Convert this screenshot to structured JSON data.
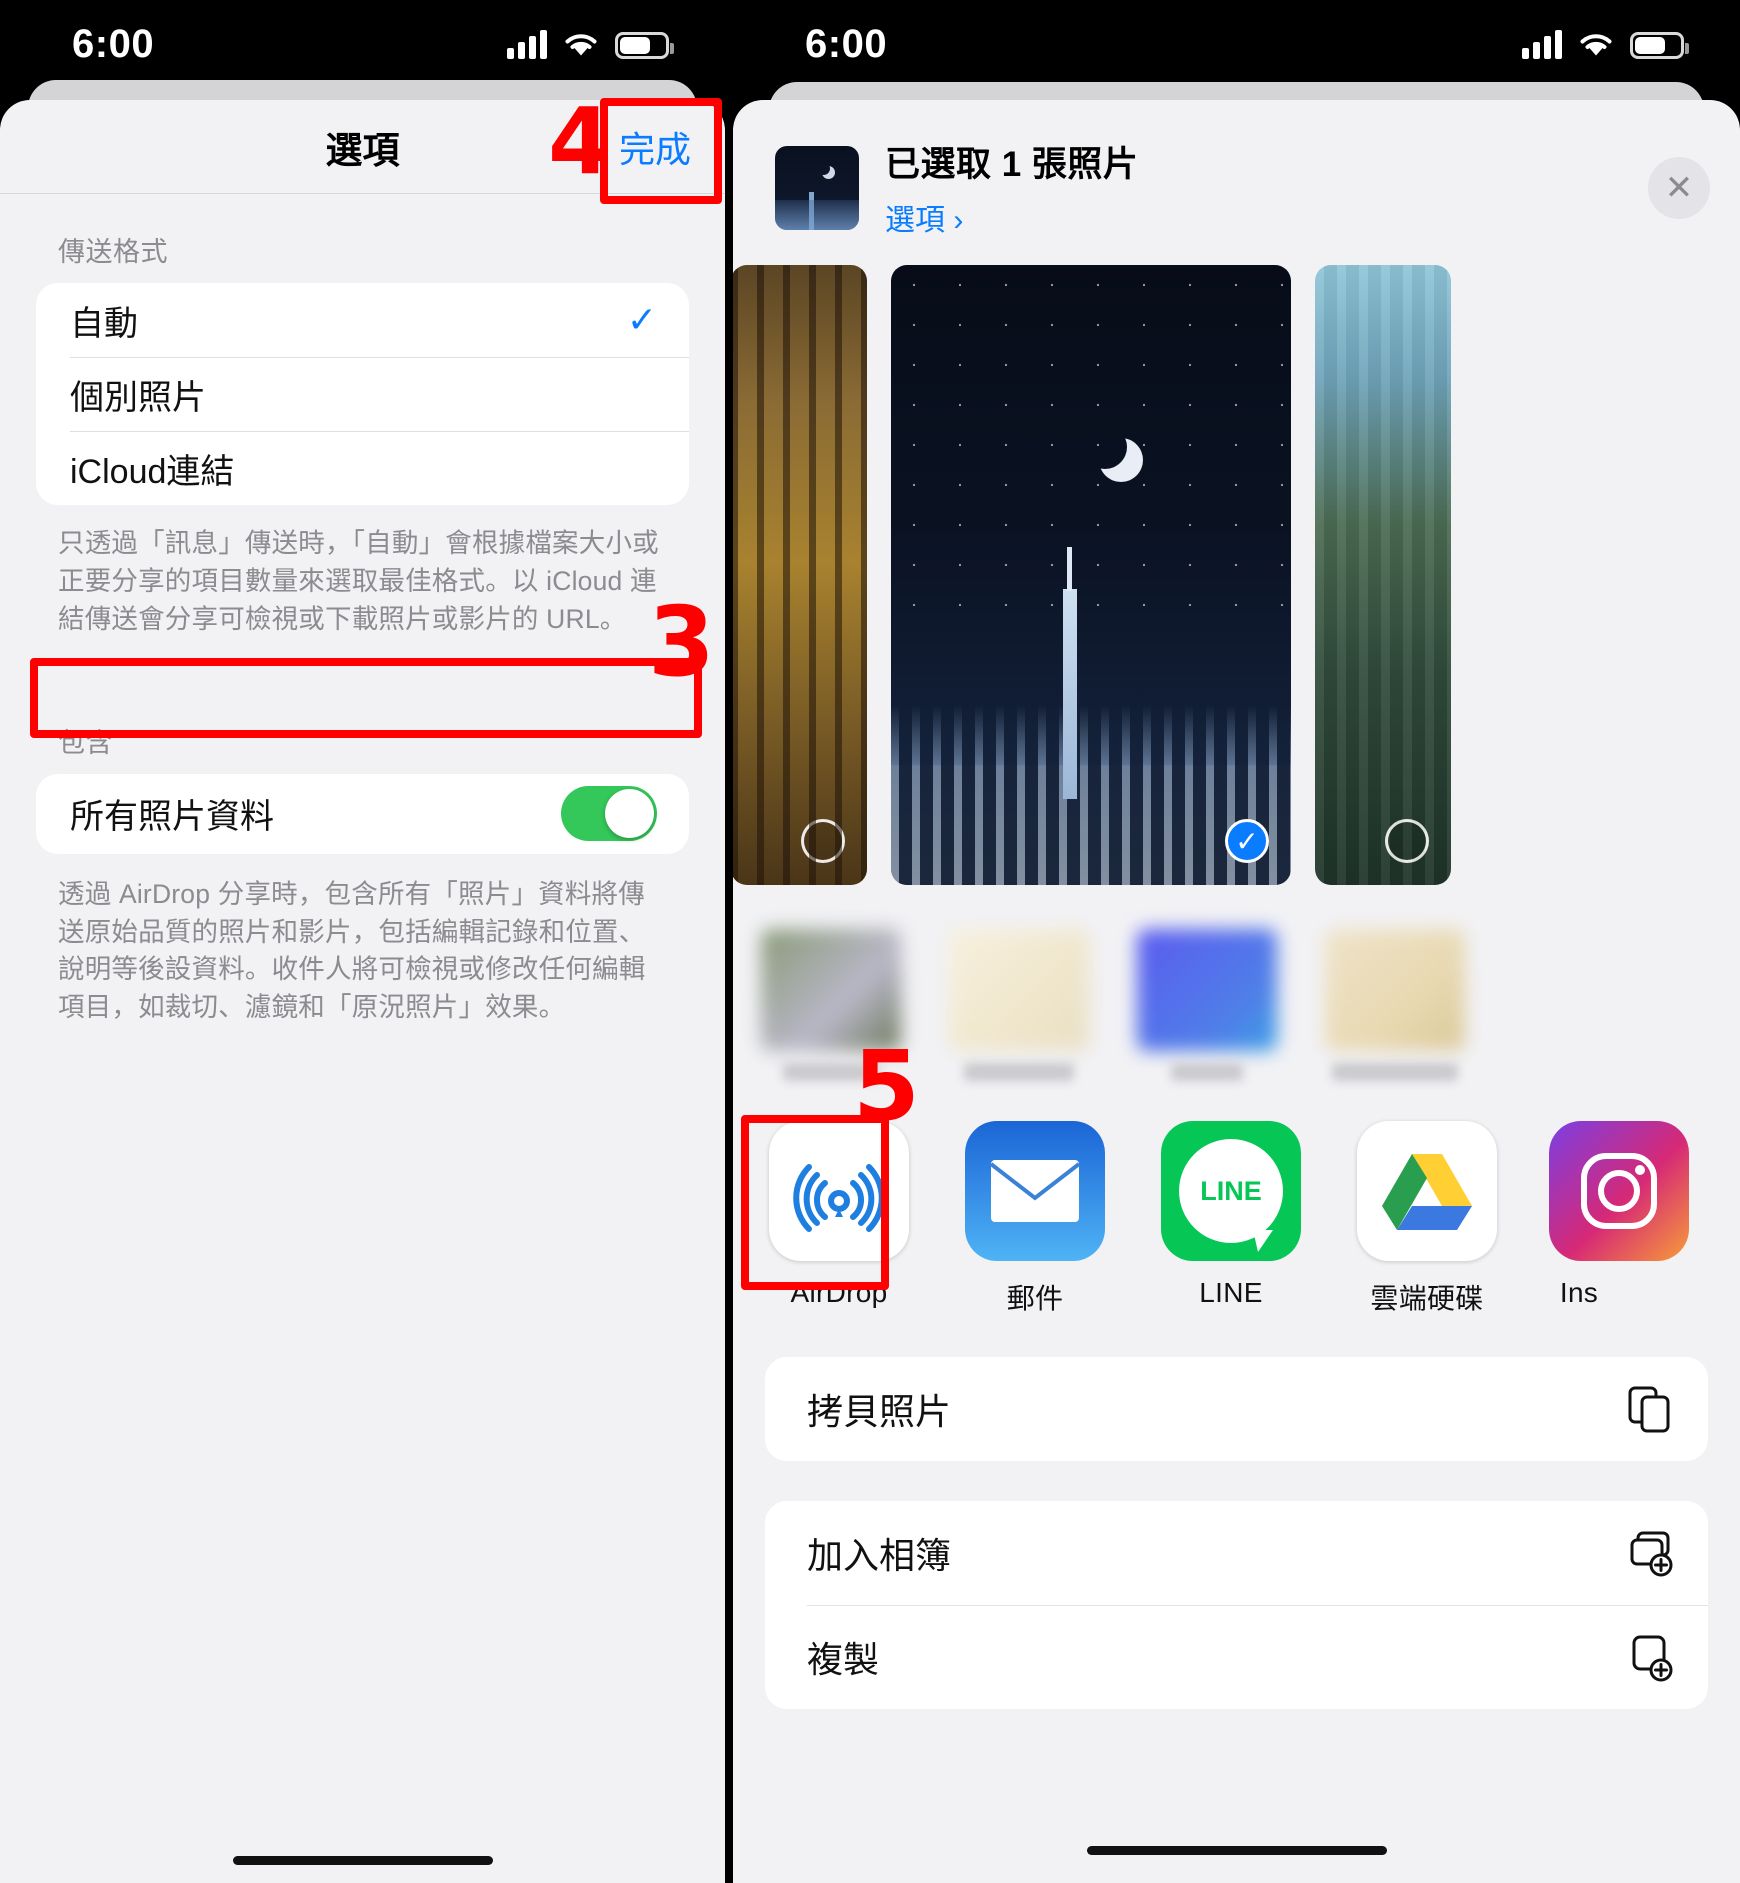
{
  "status": {
    "time": "6:00"
  },
  "left_phone": {
    "sheet_title": "選項",
    "done_label": "完成",
    "format_group_label": "傳送格式",
    "format_options": [
      {
        "label": "自動",
        "checked": true
      },
      {
        "label": "個別照片",
        "checked": false
      },
      {
        "label": "iCloud連結",
        "checked": false
      }
    ],
    "format_footnote": "只透過「訊息」傳送時，「自動」會根據檔案大小或正要分享的項目數量來選取最佳格式。以 iCloud 連結傳送會分享可檢視或下載照片或影片的 URL。",
    "include_group_label": "包含",
    "include_row": {
      "label": "所有照片資料",
      "toggle_on": true
    },
    "include_footnote": "透過 AirDrop 分享時，包含所有「照片」資料將傳送原始品質的照片和影片，包括編輯記錄和位置、說明等後設資料。收件人將可檢視或修改任何編輯項目，如裁切、濾鏡和「原況照片」效果。"
  },
  "right_phone": {
    "share_title": "已選取 1 張照片",
    "share_subtitle": "選項",
    "chevron": "›",
    "close_icon": "✕",
    "photos": [
      {
        "name": "forest-photo",
        "selected": false
      },
      {
        "name": "nyc-night-photo",
        "selected": true
      },
      {
        "name": "lake-photo",
        "selected": false
      }
    ],
    "apps": [
      {
        "label": "AirDrop",
        "icon": "airdrop-icon"
      },
      {
        "label": "郵件",
        "icon": "mail-icon"
      },
      {
        "label": "LINE",
        "icon": "line-icon"
      },
      {
        "label": "雲端硬碟",
        "icon": "google-drive-icon"
      },
      {
        "label": "Ins",
        "icon": "instagram-icon"
      }
    ],
    "actions": [
      {
        "label": "拷貝照片",
        "icon": "copy-icon"
      },
      {
        "label": "加入相簿",
        "icon": "add-to-album-icon"
      },
      {
        "label": "複製",
        "icon": "duplicate-icon"
      }
    ]
  },
  "annotations": [
    {
      "number": "3",
      "target": "all-photos-data-toggle-row"
    },
    {
      "number": "4",
      "target": "done-button"
    },
    {
      "number": "5",
      "target": "airdrop-app"
    }
  ],
  "colors": {
    "accent_blue": "#0a7cff",
    "toggle_green": "#34c759",
    "annotation_red": "#ff0000"
  }
}
